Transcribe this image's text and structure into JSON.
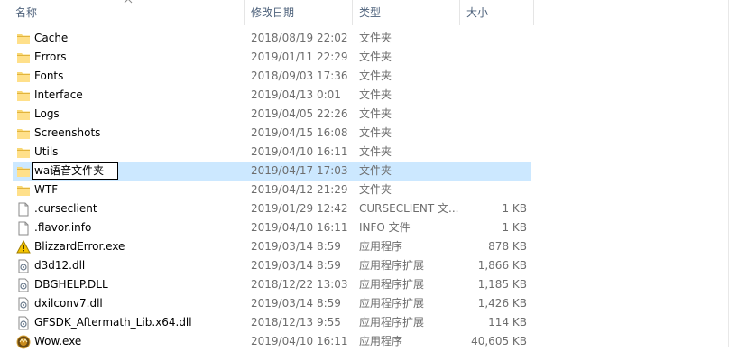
{
  "columns": {
    "name": "名称",
    "date": "修改日期",
    "type": "类型",
    "size": "大小"
  },
  "files": [
    {
      "name": "Cache",
      "date": "2018/08/19 22:02",
      "type": "文件夹",
      "size": "",
      "icon": "folder-icon"
    },
    {
      "name": "Errors",
      "date": "2019/01/11 22:29",
      "type": "文件夹",
      "size": "",
      "icon": "folder-icon"
    },
    {
      "name": "Fonts",
      "date": "2018/09/03 17:36",
      "type": "文件夹",
      "size": "",
      "icon": "folder-icon"
    },
    {
      "name": "Interface",
      "date": "2019/04/13 0:01",
      "type": "文件夹",
      "size": "",
      "icon": "folder-icon"
    },
    {
      "name": "Logs",
      "date": "2019/04/05 22:26",
      "type": "文件夹",
      "size": "",
      "icon": "folder-icon"
    },
    {
      "name": "Screenshots",
      "date": "2019/04/15 16:08",
      "type": "文件夹",
      "size": "",
      "icon": "folder-icon"
    },
    {
      "name": "Utils",
      "date": "2019/04/10 16:11",
      "type": "文件夹",
      "size": "",
      "icon": "folder-icon"
    },
    {
      "name": "wa语音文件夹",
      "date": "2019/04/17 17:03",
      "type": "文件夹",
      "size": "",
      "icon": "folder-icon",
      "selected": true,
      "renaming": true
    },
    {
      "name": "WTF",
      "date": "2019/04/12 21:29",
      "type": "文件夹",
      "size": "",
      "icon": "folder-icon"
    },
    {
      "name": ".curseclient",
      "date": "2019/01/29 12:42",
      "type": "CURSECLIENT 文...",
      "size": "1 KB",
      "icon": "file-icon"
    },
    {
      "name": ".flavor.info",
      "date": "2019/04/10 16:11",
      "type": "INFO 文件",
      "size": "1 KB",
      "icon": "file-icon"
    },
    {
      "name": "BlizzardError.exe",
      "date": "2019/03/14 8:59",
      "type": "应用程序",
      "size": "878 KB",
      "icon": "warning-icon"
    },
    {
      "name": "d3d12.dll",
      "date": "2019/03/14 8:59",
      "type": "应用程序扩展",
      "size": "1,866 KB",
      "icon": "dll-icon"
    },
    {
      "name": "DBGHELP.DLL",
      "date": "2018/12/22 13:03",
      "type": "应用程序扩展",
      "size": "1,185 KB",
      "icon": "dll-icon"
    },
    {
      "name": "dxilconv7.dll",
      "date": "2019/03/14 8:59",
      "type": "应用程序扩展",
      "size": "1,426 KB",
      "icon": "dll-icon"
    },
    {
      "name": "GFSDK_Aftermath_Lib.x64.dll",
      "date": "2018/12/13 9:55",
      "type": "应用程序扩展",
      "size": "114 KB",
      "icon": "dll-icon"
    },
    {
      "name": "Wow.exe",
      "date": "2019/04/10 16:11",
      "type": "应用程序",
      "size": "40,605 KB",
      "icon": "wow-icon"
    }
  ]
}
